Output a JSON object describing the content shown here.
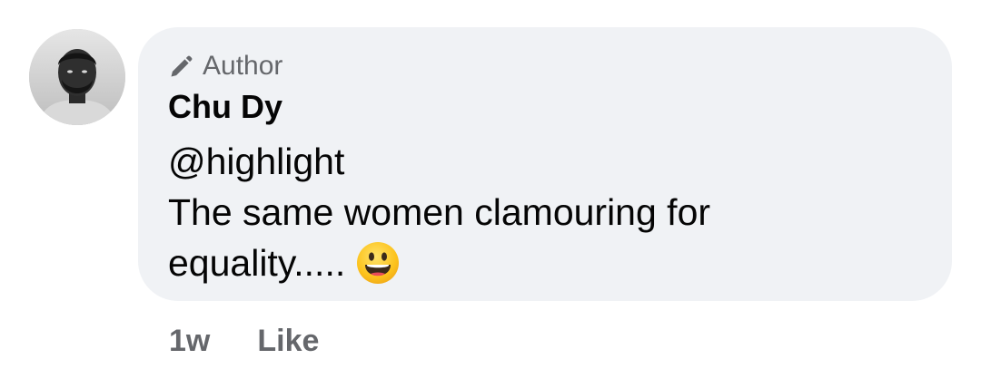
{
  "comment": {
    "badge": {
      "icon": "pencil-icon",
      "label": "Author"
    },
    "author_name": "Chu Dy",
    "mention": "@highlight",
    "text_line1": "The same women clamouring for",
    "text_line2": "equality.....",
    "emoji": "grinning-face-icon",
    "timestamp": "1w",
    "like_label": "Like",
    "colors": {
      "bubble": "#f0f2f5",
      "text": "#050505",
      "secondary": "#65676b",
      "emoji_face": "#fcc21b"
    }
  }
}
